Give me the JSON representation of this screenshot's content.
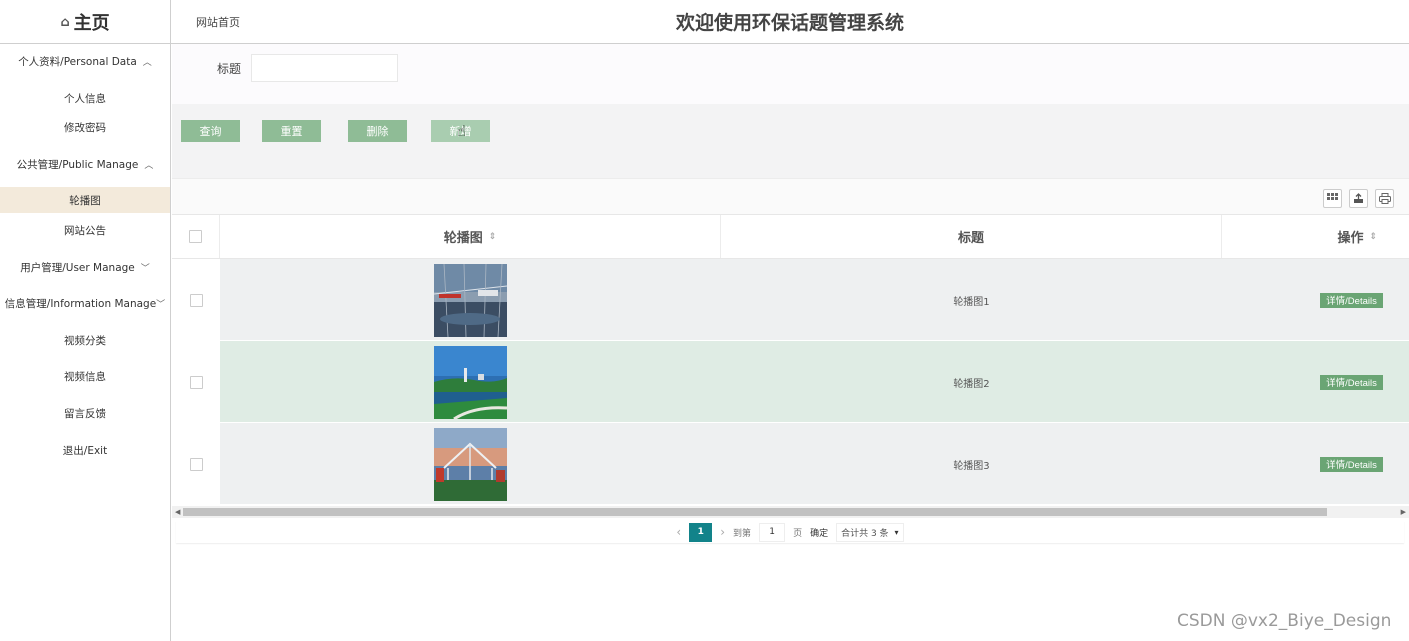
{
  "header": {
    "home_label": "主页",
    "home_icon": "home-icon",
    "breadcrumb": "网站首页",
    "title": "欢迎使用环保话题管理系统"
  },
  "sidebar": {
    "groups": [
      {
        "label": "个人资料/Personal Data",
        "state": "expanded",
        "items": [
          "个人信息",
          "修改密码"
        ]
      },
      {
        "label": "公共管理/Public Manage",
        "state": "expanded",
        "items": [
          "轮播图",
          "网站公告"
        ]
      },
      {
        "label": "用户管理/User Manage",
        "state": "collapsed",
        "items": []
      },
      {
        "label": "信息管理/Information Manage",
        "state": "collapsed",
        "items": [
          "视频分类",
          "视频信息",
          "留言反馈"
        ]
      }
    ],
    "exit_label": "退出/Exit",
    "active_item": "轮播图",
    "active_color": "#f3eadb"
  },
  "search": {
    "label": "标题",
    "value": ""
  },
  "buttons": {
    "query": "查询",
    "reset": "重置",
    "delete": "删除",
    "add": "新增",
    "color": "#8fbc96"
  },
  "toolbar_icons": [
    "columns-icon",
    "export-icon",
    "print-icon"
  ],
  "table": {
    "columns": [
      "轮播图",
      "标题",
      "操作"
    ],
    "rows": [
      {
        "title": "轮播图1",
        "action": "详情/Details",
        "image": "glass-pavilion-lake-photo"
      },
      {
        "title": "轮播图2",
        "action": "详情/Details",
        "image": "harbor-skyline-photo"
      },
      {
        "title": "轮播图3",
        "action": "详情/Details",
        "image": "sunset-pavilion-photo"
      }
    ],
    "highlight_color": "#dfece4",
    "action_color": "#6aa574"
  },
  "pagination": {
    "current": "1",
    "goto_prefix": "到第",
    "goto_value": "1",
    "goto_suffix": "页",
    "confirm": "确定",
    "total": "合计共 3 条",
    "accent": "#12838a"
  },
  "watermark": "CSDN @vx2_Biye_Design"
}
